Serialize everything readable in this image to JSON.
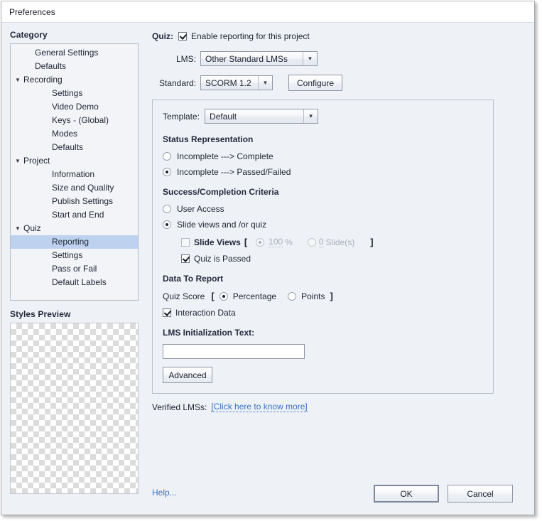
{
  "window": {
    "title": "Preferences"
  },
  "sidebar": {
    "heading": "Category",
    "items": [
      {
        "label": "General Settings",
        "level": 1,
        "twisty": "",
        "selected": false
      },
      {
        "label": "Defaults",
        "level": 1,
        "twisty": "",
        "selected": false
      },
      {
        "label": "Recording",
        "level": 0,
        "twisty": "▼",
        "selected": false
      },
      {
        "label": "Settings",
        "level": 2,
        "twisty": "",
        "selected": false
      },
      {
        "label": "Video Demo",
        "level": 2,
        "twisty": "",
        "selected": false
      },
      {
        "label": "Keys - (Global)",
        "level": 2,
        "twisty": "",
        "selected": false
      },
      {
        "label": "Modes",
        "level": 2,
        "twisty": "",
        "selected": false
      },
      {
        "label": "Defaults",
        "level": 2,
        "twisty": "",
        "selected": false
      },
      {
        "label": "Project",
        "level": 0,
        "twisty": "▼",
        "selected": false
      },
      {
        "label": "Information",
        "level": 2,
        "twisty": "",
        "selected": false
      },
      {
        "label": "Size and Quality",
        "level": 2,
        "twisty": "",
        "selected": false
      },
      {
        "label": "Publish Settings",
        "level": 2,
        "twisty": "",
        "selected": false
      },
      {
        "label": "Start and End",
        "level": 2,
        "twisty": "",
        "selected": false
      },
      {
        "label": "Quiz",
        "level": 0,
        "twisty": "▼",
        "selected": false
      },
      {
        "label": "Reporting",
        "level": 2,
        "twisty": "",
        "selected": true
      },
      {
        "label": "Settings",
        "level": 2,
        "twisty": "",
        "selected": false
      },
      {
        "label": "Pass or Fail",
        "level": 2,
        "twisty": "",
        "selected": false
      },
      {
        "label": "Default Labels",
        "level": 2,
        "twisty": "",
        "selected": false
      }
    ],
    "styles_preview_label": "Styles Preview"
  },
  "main": {
    "quiz_label": "Quiz:",
    "enable_reporting_label": "Enable reporting for this project",
    "enable_reporting_checked": true,
    "lms_label": "LMS:",
    "lms_value": "Other Standard LMSs",
    "standard_label": "Standard:",
    "standard_value": "SCORM 1.2",
    "configure_label": "Configure",
    "template_label": "Template:",
    "template_value": "Default",
    "status_representation_heading": "Status Representation",
    "status_option_1": "Incomplete ---> Complete",
    "status_option_2": "Incomplete ---> Passed/Failed",
    "status_selected": 2,
    "success_criteria_heading": "Success/Completion Criteria",
    "criteria_option_1": "User Access",
    "criteria_option_2": "Slide views and /or quiz",
    "criteria_selected": 2,
    "slide_views_label": "Slide Views",
    "slide_views_checked": false,
    "bracket_open": "[",
    "bracket_close": "]",
    "percent_value": "100",
    "percent_unit": "%",
    "percent_selected": true,
    "slides_value": "0",
    "slides_unit": "Slide(s)",
    "slides_selected": false,
    "quiz_is_passed_label": "Quiz is Passed",
    "quiz_is_passed_checked": true,
    "data_to_report_heading": "Data To Report",
    "quiz_score_label": "Quiz Score",
    "score_option_1": "Percentage",
    "score_option_2": "Points",
    "score_selected": 1,
    "interaction_data_label": "Interaction Data",
    "interaction_data_checked": true,
    "lms_init_label": "LMS Initialization Text:",
    "lms_init_value": "",
    "lms_init_placeholder": "",
    "advanced_label": "Advanced",
    "verified_lms_label": "Verified LMSs:",
    "verified_lms_link": "[Click here to know more]"
  },
  "footer": {
    "help_label": "Help...",
    "ok_label": "OK",
    "cancel_label": "Cancel"
  },
  "colors": {
    "selection": "#bed2f0",
    "link": "#3a74c4",
    "panel_bg": "#eef1f6"
  }
}
